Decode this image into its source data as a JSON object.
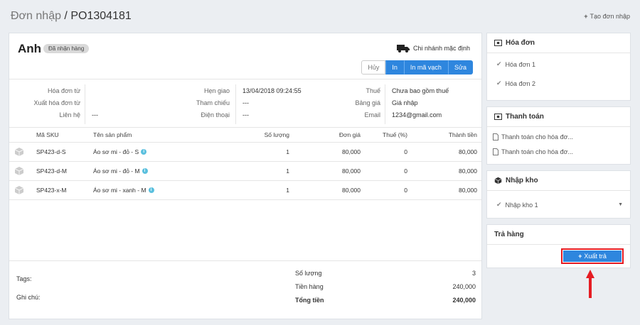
{
  "header": {
    "title_prefix": "Đơn nhập",
    "title_sep": " / ",
    "order_code": "PO1304181",
    "create_label": "Tạo đơn nhập"
  },
  "order": {
    "customer": "Anh",
    "status": "Đã nhận hàng",
    "branch": "Chi nhánh mặc định",
    "buttons": {
      "cancel": "Hủy",
      "print": "In",
      "print_barcode": "In mã vạch",
      "edit": "Sửa"
    }
  },
  "info": {
    "col1": [
      {
        "label": "Hóa đơn từ",
        "value": ""
      },
      {
        "label": "Xuất hóa đơn từ",
        "value": ""
      },
      {
        "label": "Liên hệ",
        "value": "---"
      }
    ],
    "col2": [
      {
        "label": "Hẹn giao",
        "value": "13/04/2018 09:24:55"
      },
      {
        "label": "Tham chiếu",
        "value": "---"
      },
      {
        "label": "Điện thoại",
        "value": "---"
      }
    ],
    "col3": [
      {
        "label": "Thuế",
        "value": "Chưa bao gồm thuế"
      },
      {
        "label": "Bảng giá",
        "value": "Giá nhập"
      },
      {
        "label": "Email",
        "value": "1234@gmail.com"
      }
    ]
  },
  "table": {
    "headers": {
      "sku": "Mã SKU",
      "name": "Tên sản phẩm",
      "qty": "Số lượng",
      "price": "Đơn giá",
      "tax": "Thuế (%)",
      "total": "Thành tiền"
    },
    "rows": [
      {
        "sku": "SP423-d-S",
        "name": "Áo sơ mi - đỏ - S",
        "qty": "1",
        "price": "80,000",
        "tax": "0",
        "total": "80,000"
      },
      {
        "sku": "SP423-d-M",
        "name": "Áo sơ mi - đỏ - M",
        "qty": "1",
        "price": "80,000",
        "tax": "0",
        "total": "80,000"
      },
      {
        "sku": "SP423-x-M",
        "name": "Áo sơ mi - xanh - M",
        "qty": "1",
        "price": "80,000",
        "tax": "0",
        "total": "80,000"
      }
    ]
  },
  "footer": {
    "tags_label": "Tags:",
    "notes_label": "Ghi chú:",
    "summary": [
      {
        "label": "Số lượng",
        "value": "3"
      },
      {
        "label": "Tiền hàng",
        "value": "240,000"
      },
      {
        "label": "Tổng tiền",
        "value": "240,000"
      }
    ]
  },
  "sidebar": {
    "invoice": {
      "title": "Hóa đơn",
      "items": [
        "Hóa đơn 1",
        "Hóa đơn 2"
      ]
    },
    "payment": {
      "title": "Thanh toán",
      "items": [
        "Thanh toán cho hóa đơ...",
        "Thanh toán cho hóa đơ..."
      ]
    },
    "stock": {
      "title": "Nhập kho",
      "items": [
        "Nhập kho 1"
      ]
    },
    "returns": {
      "title": "Trả hàng",
      "button": "Xuất trả"
    }
  },
  "colors": {
    "accent": "#2e86de",
    "highlight": "#e51c23"
  }
}
